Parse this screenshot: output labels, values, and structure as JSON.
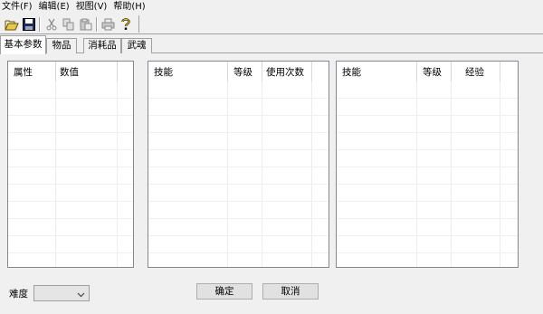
{
  "menu": [
    {
      "label": "文件(F)"
    },
    {
      "label": "编辑(E)"
    },
    {
      "label": "视图(V)"
    },
    {
      "label": "帮助(H)"
    }
  ],
  "toolbar": {
    "icons": [
      "open-folder-icon",
      "save-icon",
      "cut-icon",
      "copy-icon",
      "paste-icon",
      "print-icon",
      "help-icon"
    ]
  },
  "tabs": [
    {
      "label": "基本参数",
      "active": true
    },
    {
      "label": "物品",
      "active": false
    },
    {
      "label": "消耗品",
      "active": false
    },
    {
      "label": "武魂",
      "active": false
    }
  ],
  "panels": {
    "attributes": {
      "columns": [
        "属性",
        "数值"
      ]
    },
    "skills_usage": {
      "columns": [
        "技能",
        "等级",
        "使用次数"
      ]
    },
    "skills_exp": {
      "columns": [
        "技能",
        "等级",
        "经验"
      ]
    }
  },
  "difficulty": {
    "label": "难度",
    "value": ""
  },
  "buttons": {
    "ok": "确定",
    "cancel": "取消"
  }
}
